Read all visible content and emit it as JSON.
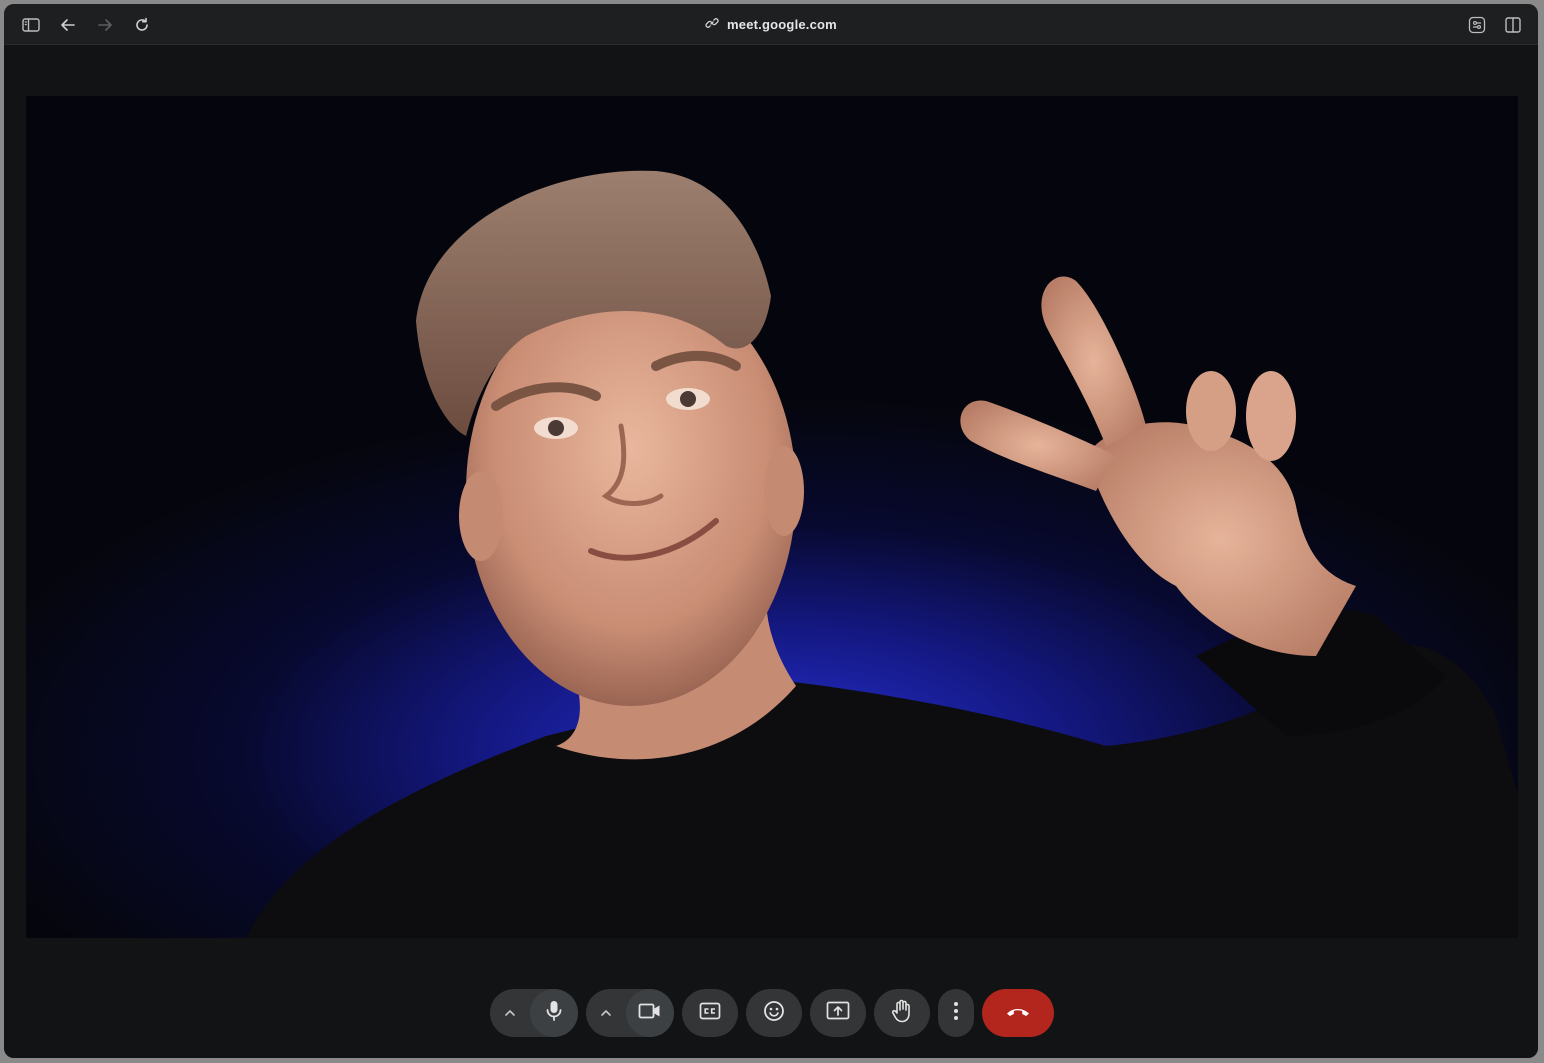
{
  "browser": {
    "url": "meet.google.com",
    "icons": {
      "sidebar": "sidebar-toggle-icon",
      "back": "back-arrow-icon",
      "forward": "forward-arrow-icon",
      "reload": "reload-icon",
      "link": "link-icon",
      "extensions": "page-settings-icon",
      "split": "split-view-icon"
    }
  },
  "meeting": {
    "video": "participant-camera-feed",
    "controls": [
      {
        "name": "audio-options",
        "icon": "chevron-up-icon"
      },
      {
        "name": "microphone",
        "icon": "microphone-icon"
      },
      {
        "name": "video-options",
        "icon": "chevron-up-icon"
      },
      {
        "name": "camera",
        "icon": "camera-icon"
      },
      {
        "name": "captions",
        "icon": "closed-captions-icon"
      },
      {
        "name": "reactions",
        "icon": "emoji-icon"
      },
      {
        "name": "present",
        "icon": "present-screen-icon"
      },
      {
        "name": "raise-hand",
        "icon": "hand-icon"
      },
      {
        "name": "more-options",
        "icon": "more-vertical-icon"
      },
      {
        "name": "leave-call",
        "icon": "hang-up-icon"
      }
    ],
    "colors": {
      "hangup": "#b3261e",
      "control_bg": "#333537",
      "background": "#121314"
    }
  }
}
